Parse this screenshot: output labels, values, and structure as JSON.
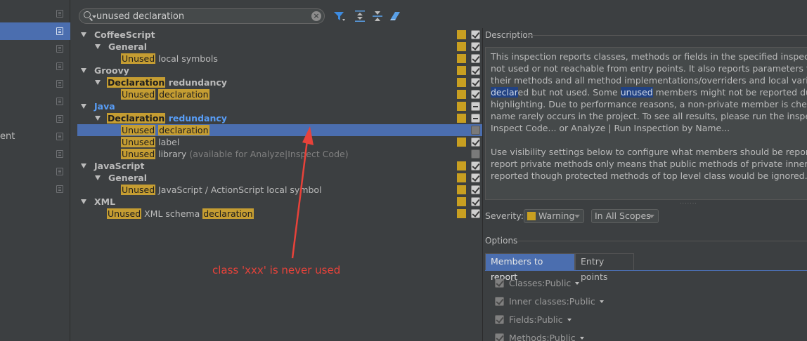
{
  "sidebar": {
    "partial_label": "ent"
  },
  "search": {
    "value": "unused declaration",
    "icon": "search-icon"
  },
  "toolbar": {
    "icons": [
      "filter-icon",
      "expand-all-icon",
      "collapse-all-icon",
      "reset-icon"
    ]
  },
  "tree": {
    "coffeescript": "CoffeeScript",
    "coffeescript_general": "General",
    "coffeescript_unused_hl": "Unused",
    "coffeescript_unused_rest": " local symbols",
    "groovy": "Groovy",
    "groovy_decl_hl": "Declaration",
    "groovy_decl_rest": " redundancy",
    "groovy_unused_hl": "Unused",
    "groovy_unused_decl_hl": "declaration",
    "java": "Java",
    "java_decl_hl": "Declaration",
    "java_decl_rest": " redundancy",
    "java_unused_hl": "Unused",
    "java_unused_decl_hl": "declaration",
    "java_label_hl": "Unused",
    "java_label_rest": " label",
    "java_library_hl": "Unused",
    "java_library_rest": " library",
    "java_library_note": " (available for Analyze|Inspect Code)",
    "javascript": "JavaScript",
    "javascript_general": "General",
    "javascript_unused_hl": "Unused",
    "javascript_unused_rest": " JavaScript / ActionScript local symbol",
    "xml": "XML",
    "xml_unused_hl": "Unused",
    "xml_mid": " XML schema ",
    "xml_decl_hl": "declaration"
  },
  "description": {
    "title": "Description",
    "line1": "This inspection reports classes, methods or fields in the specified inspection s",
    "line2": "not used or not reachable from entry points. It also reports parameters that a",
    "line3": "their methods and all method implementations/overriders and local variables",
    "line4_sel": "declar",
    "line4_a": "ed but not used. Some ",
    "line4_hl": "unused",
    "line4_b": " members might not be reported during",
    "line5": "highlighting. Due to performance reasons, a non-private member is checked o",
    "line6": "name rarely occurs in the project. To see all results, please run the inspection",
    "line7": "Inspect Code... or Analyze | Run Inspection by Name...",
    "line8": "Use visibility settings below to configure what members should be reported, e",
    "line9": "report private methods only means that public methods of private inner class",
    "line10": "reported though protected methods of top level class would be ignored."
  },
  "severity": {
    "label": "Severity:",
    "value": "Warning",
    "scope": "In All Scopes",
    "warning_color": "#c89f21"
  },
  "options": {
    "title": "Options",
    "tabs": [
      "Members to report",
      "Entry points"
    ],
    "rows": [
      {
        "label": "Classes:",
        "value": "Public"
      },
      {
        "label": "Inner classes:",
        "value": "Public"
      },
      {
        "label": "Fields:",
        "value": "Public"
      },
      {
        "label": "Methods:",
        "value": "Public"
      }
    ]
  },
  "annotation": {
    "text": "class 'xxx' is never used",
    "color": "#e8423a"
  }
}
